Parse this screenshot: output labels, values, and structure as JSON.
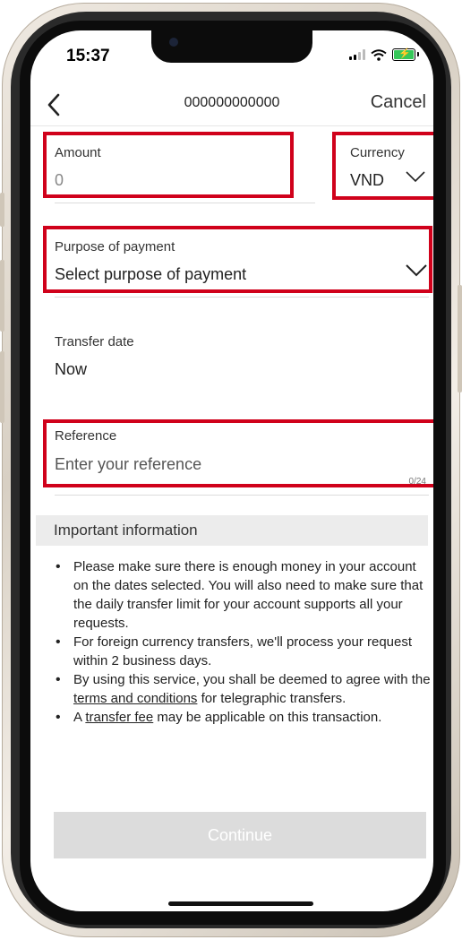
{
  "status_bar": {
    "time": "15:37"
  },
  "nav": {
    "title": "000000000000",
    "cancel_label": "Cancel",
    "back_icon": "chevron-left-icon"
  },
  "form": {
    "amount": {
      "label": "Amount",
      "value": "0"
    },
    "currency": {
      "label": "Currency",
      "value": "VND",
      "icon": "chevron-down-icon"
    },
    "purpose": {
      "label": "Purpose of payment",
      "value": "Select purpose of payment",
      "icon": "chevron-down-icon"
    },
    "transfer_date": {
      "label": "Transfer date",
      "value": "Now"
    },
    "reference": {
      "label": "Reference",
      "placeholder": "Enter your reference",
      "counter": "0/24"
    }
  },
  "important": {
    "title": "Important information",
    "bullets": [
      {
        "text": "Please make sure there is enough money in your account on the dates selected. You will also need to make sure that the daily transfer limit for your account supports all your requests."
      },
      {
        "text": "For foreign currency transfers, we'll process your request within 2 business days."
      },
      {
        "pre": "By using this service, you shall be deemed to agree with the ",
        "link": "terms and conditions",
        "post": " for telegraphic transfers."
      },
      {
        "pre": "A ",
        "link": "transfer fee",
        "post": " may be applicable on this transaction."
      }
    ]
  },
  "continue_label": "Continue",
  "colors": {
    "highlight": "#d0011b",
    "disabled_button": "#dcdcdc",
    "info_header_bg": "#ececec"
  }
}
